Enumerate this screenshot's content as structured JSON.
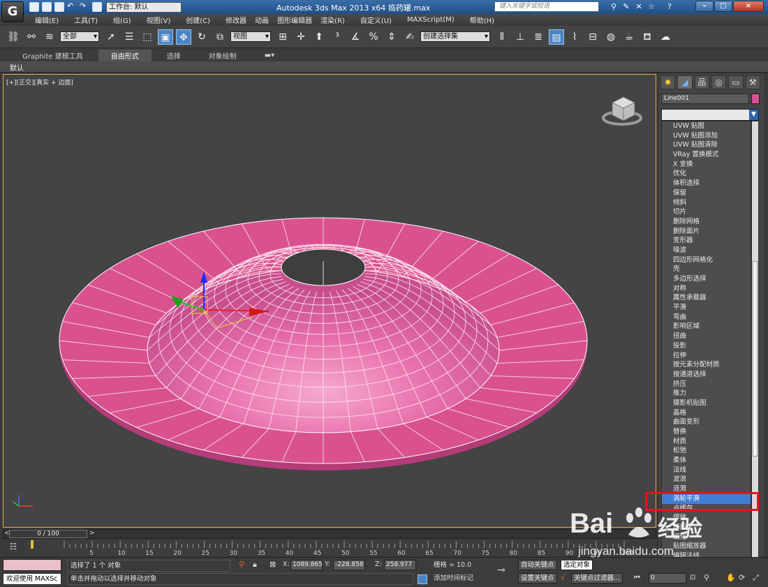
{
  "titlebar": {
    "app_icon": "3dsmax-logo-icon",
    "workspace": "工作台: 默认",
    "title": "Autodesk 3ds Max  2013 x64     捣药罐.max",
    "search_placeholder": "键入关键字或短语",
    "controls": [
      "–",
      "□",
      "×"
    ]
  },
  "menu": [
    "编辑(E)",
    "工具(T)",
    "组(G)",
    "视图(V)",
    "创建(C)",
    "修改器",
    "动画",
    "图形编辑器",
    "渲染(R)",
    "自定义(U)",
    "MAXScript(M)",
    "帮助(H)"
  ],
  "toolbar": {
    "selection_filter": "全部",
    "ref_coord": "视图",
    "named_selection": "创建选择集"
  },
  "ribbon": {
    "tabs": [
      "Graphite 建模工具",
      "自由形式",
      "选择",
      "对象绘制"
    ],
    "active_tab": 1,
    "panel_label": "默认"
  },
  "viewport": {
    "label": "[+][正交][真实 + 边面]",
    "object_color": "#d9528f"
  },
  "command_panel": {
    "object_name": "Line001",
    "object_color": "#d9528f",
    "modifiers": [
      "UVW 贴图",
      "UVW 贴图添加",
      "UVW 贴图清除",
      "VRay 置换模式",
      "X 变换",
      "优化",
      "体积选择",
      "保留",
      "倾斜",
      "切片",
      "删除网格",
      "删除面片",
      "变形器",
      "噪波",
      "四边形网格化",
      "壳",
      "多边形选择",
      "对称",
      "属性承载器",
      "平滑",
      "弯曲",
      "影响区域",
      "扭曲",
      "投影",
      "拉伸",
      "按元素分配材质",
      "按通道选择",
      "挤压",
      "推力",
      "摄影机贴图",
      "晶格",
      "曲面变形",
      "替换",
      "材质",
      "松弛",
      "柔体",
      "法线",
      "波浪",
      "涟漪",
      "涡轮平滑",
      "点缓存",
      "焊接",
      "球形化",
      "细化",
      "贴图缩放器",
      "编辑法线"
    ],
    "selected_modifier": "涡轮平滑"
  },
  "timeline": {
    "slider_label": "0 / 100",
    "ticks": [
      0,
      5,
      10,
      15,
      20,
      25,
      30,
      35,
      40,
      45,
      50,
      55,
      60,
      65,
      70,
      75,
      80,
      85,
      90,
      95,
      100
    ]
  },
  "status": {
    "maxscript": "欢迎使用 MAXSc",
    "selected": "选择了 1 个 对象",
    "prompt": "单击并拖动以选择并移动对象",
    "x_label": "X:",
    "x": "1089.865",
    "y_label": "Y:",
    "y": "-228.858",
    "z_label": "Z:",
    "z": "258.977",
    "grid": "栅格 = 10.0",
    "add_time_tag": "添加时间标记",
    "auto_key": "自动关键点",
    "selected_object": "选定对象",
    "set_key": "设置关键点",
    "key_filters": "关键点过滤器...",
    "frame": "0"
  },
  "watermark": {
    "brand": "Bai",
    "brand2": "经验",
    "url": "jingyan.baidu.com"
  }
}
